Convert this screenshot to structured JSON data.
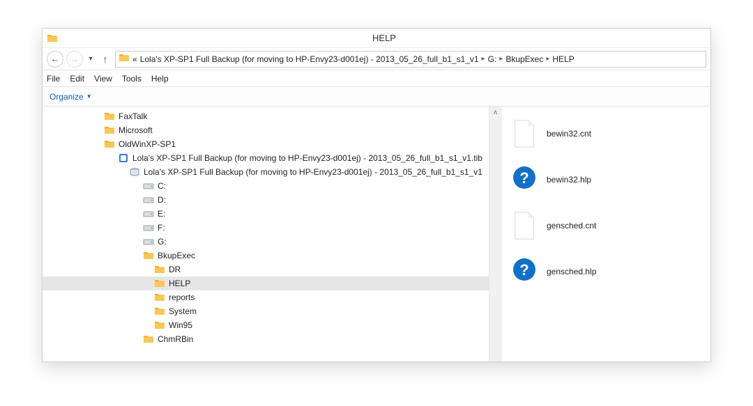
{
  "window": {
    "title": "HELP"
  },
  "breadcrumbs": {
    "prefix": "«",
    "items": [
      "Lola's XP-SP1 Full Backup (for moving to HP-Envy23-d001ej) - 2013_05_26_full_b1_s1_v1",
      "G:",
      "BkupExec",
      "HELP"
    ]
  },
  "menubar": [
    "File",
    "Edit",
    "View",
    "Tools",
    "Help"
  ],
  "toolbar": {
    "organize": "Organize"
  },
  "tree": [
    {
      "indent": 88,
      "icon": "folder",
      "label": "FaxTalk"
    },
    {
      "indent": 88,
      "icon": "folder",
      "label": "Microsoft"
    },
    {
      "indent": 88,
      "icon": "folder",
      "label": "OldWinXP-SP1"
    },
    {
      "indent": 108,
      "icon": "tib",
      "label": "Lola's XP-SP1 Full Backup (for moving to HP-Envy23-d001ej) - 2013_05_26_full_b1_s1_v1.tib"
    },
    {
      "indent": 124,
      "icon": "image",
      "label": "Lola's XP-SP1 Full Backup (for moving to HP-Envy23-d001ej) - 2013_05_26_full_b1_s1_v1"
    },
    {
      "indent": 144,
      "icon": "drive",
      "label": "C:"
    },
    {
      "indent": 144,
      "icon": "drive",
      "label": "D:"
    },
    {
      "indent": 144,
      "icon": "drive",
      "label": "E:"
    },
    {
      "indent": 144,
      "icon": "drive",
      "label": "F:"
    },
    {
      "indent": 144,
      "icon": "drive",
      "label": "G:"
    },
    {
      "indent": 144,
      "icon": "folder",
      "label": "BkupExec"
    },
    {
      "indent": 160,
      "icon": "folder",
      "label": "DR"
    },
    {
      "indent": 160,
      "icon": "folder",
      "label": "HELP",
      "selected": true
    },
    {
      "indent": 160,
      "icon": "folder",
      "label": "reports"
    },
    {
      "indent": 160,
      "icon": "folder",
      "label": "System"
    },
    {
      "indent": 160,
      "icon": "folder",
      "label": "Win95"
    },
    {
      "indent": 144,
      "icon": "folder",
      "label": "ChmRBin"
    }
  ],
  "files": [
    {
      "icon": "blank",
      "label": "bewin32.cnt"
    },
    {
      "icon": "help",
      "label": "bewin32.hlp"
    },
    {
      "icon": "blank",
      "label": "gensched.cnt"
    },
    {
      "icon": "help",
      "label": "gensched.hlp"
    }
  ]
}
